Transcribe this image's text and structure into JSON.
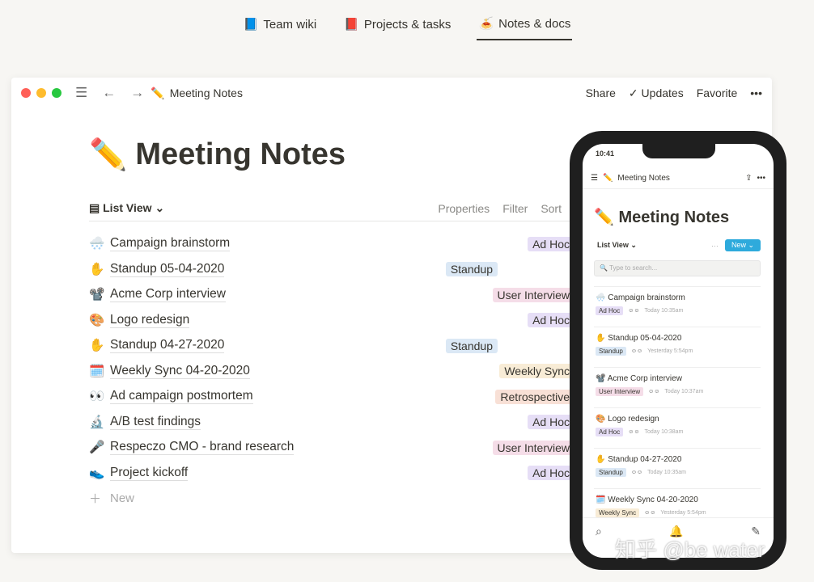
{
  "top_tabs": [
    {
      "icon": "📘",
      "label": "Team wiki"
    },
    {
      "icon": "📕",
      "label": "Projects & tasks"
    },
    {
      "icon": "🍝",
      "label": "Notes & docs",
      "active": true
    }
  ],
  "window": {
    "breadcrumb_icon": "✏️",
    "breadcrumb": "Meeting Notes",
    "share": "Share",
    "updates": "Updates",
    "favorite": "Favorite",
    "more": "•••",
    "title_icon": "✏️",
    "title": "Meeting Notes",
    "view": "List View",
    "properties": "Properties",
    "filter": "Filter",
    "sort": "Sort",
    "new": "New",
    "rows": [
      {
        "icon": "🌨️",
        "title": "Campaign brainstorm",
        "tag": "Ad Hoc",
        "color": "#e6def6"
      },
      {
        "icon": "✋",
        "title": "Standup 05-04-2020",
        "tag": "Standup",
        "color": "#dbe8f5"
      },
      {
        "icon": "📽️",
        "title": "Acme Corp interview",
        "tag": "User Interview",
        "color": "#f5dde8"
      },
      {
        "icon": "🎨",
        "title": "Logo redesign",
        "tag": "Ad Hoc",
        "color": "#e6def6"
      },
      {
        "icon": "✋",
        "title": "Standup 04-27-2020",
        "tag": "Standup",
        "color": "#dbe8f5"
      },
      {
        "icon": "🗓️",
        "title": "Weekly Sync 04-20-2020",
        "tag": "Weekly Sync",
        "color": "#f8ecd6"
      },
      {
        "icon": "👀",
        "title": "Ad campaign postmortem",
        "tag": "Retrospective",
        "color": "#f8e0d6"
      },
      {
        "icon": "🔬",
        "title": "A/B test findings",
        "tag": "Ad Hoc",
        "color": "#e6def6"
      },
      {
        "icon": "🎤",
        "title": "Respeczo CMO - brand research",
        "tag": "User Interview",
        "color": "#f5dde8"
      },
      {
        "icon": "👟",
        "title": "Project kickoff",
        "tag": "Ad Hoc",
        "color": "#e6def6"
      }
    ]
  },
  "phone": {
    "time": "10:41",
    "breadcrumb": "Meeting Notes",
    "title": "Meeting Notes",
    "view": "List View",
    "more": "···",
    "new": "New",
    "search_placeholder": "Type to search...",
    "items": [
      {
        "icon": "🌨️",
        "title": "Campaign brainstorm",
        "tag": "Ad Hoc",
        "color": "#e6def6",
        "time": "Today 10:35am"
      },
      {
        "icon": "✋",
        "title": "Standup 05-04-2020",
        "tag": "Standup",
        "color": "#dbe8f5",
        "time": "Yesterday 5:54pm"
      },
      {
        "icon": "📽️",
        "title": "Acme Corp interview",
        "tag": "User Interview",
        "color": "#f5dde8",
        "time": "Today 10:37am"
      },
      {
        "icon": "🎨",
        "title": "Logo redesign",
        "tag": "Ad Hoc",
        "color": "#e6def6",
        "time": "Today 10:38am"
      },
      {
        "icon": "✋",
        "title": "Standup 04-27-2020",
        "tag": "Standup",
        "color": "#dbe8f5",
        "time": "Today 10:35am"
      },
      {
        "icon": "🗓️",
        "title": "Weekly Sync 04-20-2020",
        "tag": "Weekly Sync",
        "color": "#f8ecd6",
        "time": "Yesterday 5:54pm"
      }
    ]
  },
  "watermark": "知乎 @be water"
}
